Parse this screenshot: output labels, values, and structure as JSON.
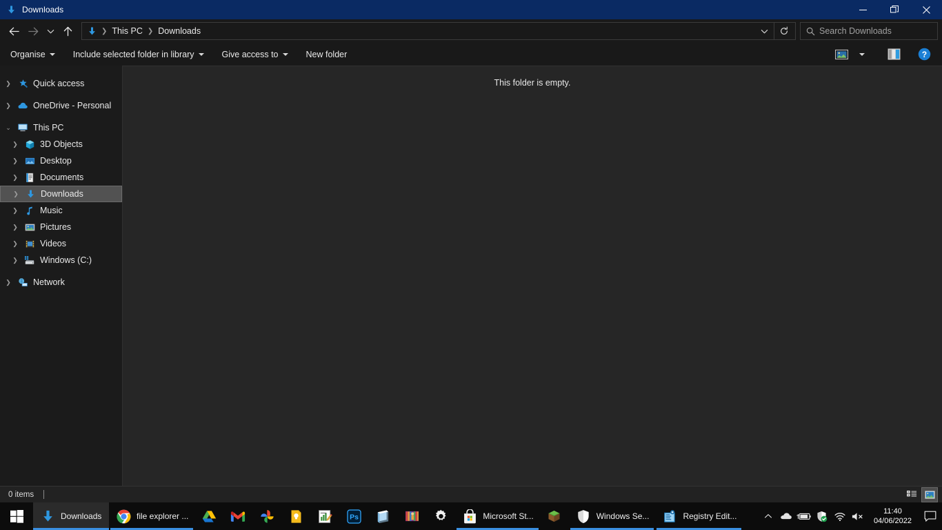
{
  "window": {
    "title": "Downloads",
    "title_icon": "downloads-arrow-icon",
    "minimize_label": "Minimize",
    "restore_label": "Restore",
    "close_label": "Close"
  },
  "nav": {
    "back_label": "Back",
    "forward_label": "Forward",
    "recent_label": "Recent locations",
    "up_label": "Up",
    "dropdown_label": "Previous locations",
    "refresh_label": "Refresh",
    "breadcrumbs": [
      {
        "label": "This PC"
      },
      {
        "label": "Downloads"
      }
    ]
  },
  "search": {
    "placeholder": "Search Downloads",
    "value": "",
    "icon": "search-icon"
  },
  "commandbar": {
    "items": [
      {
        "label": "Organise",
        "has_caret": true
      },
      {
        "label": "Include selected folder in library",
        "has_caret": true
      },
      {
        "label": "Give access to",
        "has_caret": true
      },
      {
        "label": "New folder",
        "has_caret": false
      }
    ],
    "view_options_label": "Change your view",
    "view_caret_label": "More options",
    "preview_pane_label": "Show the preview pane",
    "help_label": "Help"
  },
  "sidebar": {
    "items": [
      {
        "label": "Quick access",
        "level": 0,
        "icon": "star-icon",
        "expandable": true,
        "expanded": false,
        "selected": false
      },
      {
        "label": "OneDrive - Personal",
        "level": 0,
        "icon": "cloud-icon",
        "expandable": true,
        "expanded": false,
        "selected": false
      },
      {
        "label": "This PC",
        "level": 0,
        "icon": "monitor-icon",
        "expandable": true,
        "expanded": true,
        "selected": false
      },
      {
        "label": "3D Objects",
        "level": 1,
        "icon": "cube-icon",
        "expandable": true,
        "expanded": false,
        "selected": false
      },
      {
        "label": "Desktop",
        "level": 1,
        "icon": "desktop-icon",
        "expandable": true,
        "expanded": false,
        "selected": false
      },
      {
        "label": "Documents",
        "level": 1,
        "icon": "document-icon",
        "expandable": true,
        "expanded": false,
        "selected": false
      },
      {
        "label": "Downloads",
        "level": 1,
        "icon": "downloads-icon",
        "expandable": true,
        "expanded": false,
        "selected": true
      },
      {
        "label": "Music",
        "level": 1,
        "icon": "music-note-icon",
        "expandable": true,
        "expanded": false,
        "selected": false
      },
      {
        "label": "Pictures",
        "level": 1,
        "icon": "picture-icon",
        "expandable": true,
        "expanded": false,
        "selected": false
      },
      {
        "label": "Videos",
        "level": 1,
        "icon": "video-icon",
        "expandable": true,
        "expanded": false,
        "selected": false
      },
      {
        "label": "Windows (C:)",
        "level": 1,
        "icon": "drive-icon",
        "expandable": true,
        "expanded": false,
        "selected": false
      },
      {
        "label": "Network",
        "level": 0,
        "icon": "network-icon",
        "expandable": true,
        "expanded": false,
        "selected": false
      }
    ]
  },
  "content": {
    "empty_message": "This folder is empty."
  },
  "statusbar": {
    "item_count": "0 items",
    "details_view_label": "Details view",
    "large_icons_view_label": "Large icons view",
    "active_view": "large-icons"
  },
  "taskbar": {
    "start_label": "Start",
    "items": [
      {
        "icon": "downloads-arrow-icon",
        "label": "Downloads",
        "has_label": true,
        "state": "active"
      },
      {
        "icon": "chrome-icon",
        "label": "file explorer ...",
        "has_label": true,
        "state": "running"
      },
      {
        "icon": "google-drive-icon",
        "label": "",
        "has_label": false,
        "state": "pinned"
      },
      {
        "icon": "gmail-icon",
        "label": "",
        "has_label": false,
        "state": "pinned"
      },
      {
        "icon": "google-photos-icon",
        "label": "",
        "has_label": false,
        "state": "pinned"
      },
      {
        "icon": "google-keep-icon",
        "label": "",
        "has_label": false,
        "state": "pinned"
      },
      {
        "icon": "notes-chart-icon",
        "label": "",
        "has_label": false,
        "state": "pinned"
      },
      {
        "icon": "photoshop-icon",
        "label": "",
        "has_label": false,
        "state": "pinned"
      },
      {
        "icon": "notepad-icon",
        "label": "",
        "has_label": false,
        "state": "pinned"
      },
      {
        "icon": "winrar-icon",
        "label": "",
        "has_label": false,
        "state": "pinned"
      },
      {
        "icon": "settings-gear-icon",
        "label": "",
        "has_label": false,
        "state": "pinned"
      },
      {
        "icon": "microsoft-store-icon",
        "label": "Microsoft St...",
        "has_label": true,
        "state": "running"
      },
      {
        "icon": "minecraft-icon",
        "label": "",
        "has_label": false,
        "state": "pinned"
      },
      {
        "icon": "windows-security-icon",
        "label": "Windows Se...",
        "has_label": true,
        "state": "running"
      },
      {
        "icon": "registry-editor-icon",
        "label": "Registry Edit...",
        "has_label": true,
        "state": "running"
      }
    ],
    "tray": {
      "show_hidden_label": "Show hidden icons",
      "icons": [
        {
          "name": "onedrive-cloud-icon"
        },
        {
          "name": "battery-charging-icon"
        },
        {
          "name": "security-shield-icon"
        },
        {
          "name": "wifi-icon"
        },
        {
          "name": "volume-muted-icon"
        }
      ],
      "time": "11:40",
      "date": "04/06/2022",
      "action_center_label": "Notifications"
    }
  },
  "colors": {
    "titlebar": "#0a2a63",
    "accent_blue": "#2e8ad8",
    "chrome_dark": "#191919",
    "content_bg": "#262626",
    "sidebar_bg": "#1b1b1b",
    "selection": "#525252",
    "taskbar": "#0c0c0c",
    "underline": "#3a8fe0"
  }
}
